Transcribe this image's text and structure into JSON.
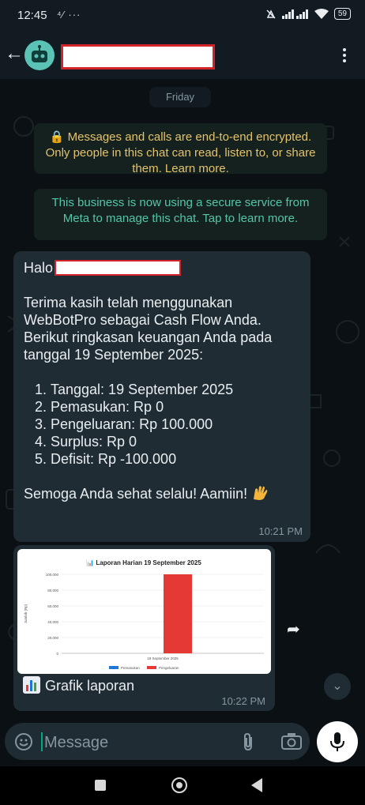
{
  "status_bar": {
    "time": "12:45",
    "left_icons": "⁴⁄ ···",
    "battery": "59",
    "icons": [
      "signal-off-icon",
      "signal-icon",
      "wifi-icon",
      "battery-icon"
    ]
  },
  "app_bar": {
    "back_icon": "arrow-left-icon",
    "avatar_icon": "robot-icon",
    "menu_icon": "more-vertical-icon"
  },
  "chat": {
    "day_chip": "Friday",
    "encryption_notice": "🔒 Messages and calls are end-to-end encrypted. Only people in this chat can read, listen to, or share them. Learn more.",
    "business_notice": "This business is now using a secure service from Meta to manage this chat. Tap to learn more.",
    "message1": {
      "greeting": "Halo",
      "intro": "Terima kasih telah menggunakan WebBotPro sebagai Cash Flow Anda. Berikut ringkasan keuangan Anda pada tanggal 19 September 2025:",
      "items": [
        "Tanggal: 19 September 2025",
        "Pemasukan: Rp 0",
        "Pengeluaran: Rp 100.000",
        "Surplus: Rp 0",
        "Defisit: Rp -100.000"
      ],
      "closing": "Semoga Anda sehat selalu! Aamiin!",
      "time": "10:21 PM"
    },
    "message2": {
      "caption": "Grafik laporan",
      "time": "10:22 PM"
    }
  },
  "chart_data": {
    "type": "bar",
    "title": "📊 Laporan Harian 19 September 2025",
    "categories": [
      "19 September 2025"
    ],
    "series": [
      {
        "name": "Pemasukan",
        "values": [
          0
        ],
        "color": "#1f77d4"
      },
      {
        "name": "Pengeluaran",
        "values": [
          100000
        ],
        "color": "#e53935"
      }
    ],
    "ylabel": "Jumlah (Rp)",
    "xlabel": "",
    "ylim": [
      0,
      100000
    ],
    "yticks": [
      "0",
      "20,000",
      "40,000",
      "60,000",
      "80,000",
      "100,000"
    ],
    "legend": "bottom",
    "grid": true
  },
  "composer": {
    "placeholder": "Message",
    "emoji_icon": "sticker-icon",
    "attach_icon": "paperclip-icon",
    "camera_icon": "camera-icon",
    "mic_icon": "mic-icon"
  },
  "nav_bar": {
    "icons": [
      "recents-icon",
      "home-icon",
      "back-icon"
    ]
  }
}
